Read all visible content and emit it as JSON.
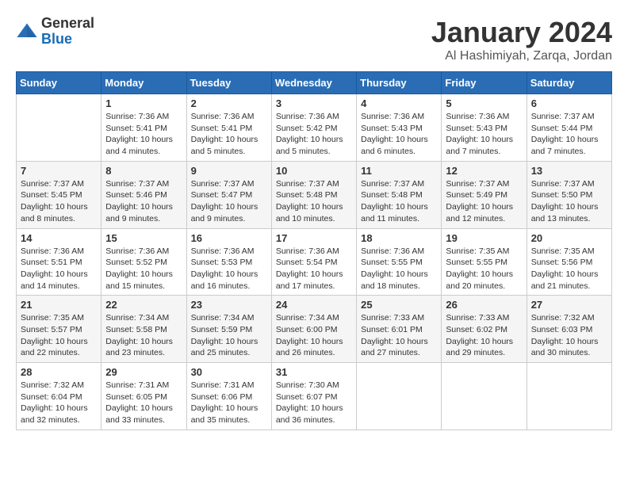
{
  "logo": {
    "text_general": "General",
    "text_blue": "Blue"
  },
  "title": "January 2024",
  "subtitle": "Al Hashimiyah, Zarqa, Jordan",
  "days_of_week": [
    "Sunday",
    "Monday",
    "Tuesday",
    "Wednesday",
    "Thursday",
    "Friday",
    "Saturday"
  ],
  "weeks": [
    [
      {
        "day": "",
        "sunrise": "",
        "sunset": "",
        "daylight": ""
      },
      {
        "day": "1",
        "sunrise": "Sunrise: 7:36 AM",
        "sunset": "Sunset: 5:41 PM",
        "daylight": "Daylight: 10 hours and 4 minutes."
      },
      {
        "day": "2",
        "sunrise": "Sunrise: 7:36 AM",
        "sunset": "Sunset: 5:41 PM",
        "daylight": "Daylight: 10 hours and 5 minutes."
      },
      {
        "day": "3",
        "sunrise": "Sunrise: 7:36 AM",
        "sunset": "Sunset: 5:42 PM",
        "daylight": "Daylight: 10 hours and 5 minutes."
      },
      {
        "day": "4",
        "sunrise": "Sunrise: 7:36 AM",
        "sunset": "Sunset: 5:43 PM",
        "daylight": "Daylight: 10 hours and 6 minutes."
      },
      {
        "day": "5",
        "sunrise": "Sunrise: 7:36 AM",
        "sunset": "Sunset: 5:43 PM",
        "daylight": "Daylight: 10 hours and 7 minutes."
      },
      {
        "day": "6",
        "sunrise": "Sunrise: 7:37 AM",
        "sunset": "Sunset: 5:44 PM",
        "daylight": "Daylight: 10 hours and 7 minutes."
      }
    ],
    [
      {
        "day": "7",
        "sunrise": "Sunrise: 7:37 AM",
        "sunset": "Sunset: 5:45 PM",
        "daylight": "Daylight: 10 hours and 8 minutes."
      },
      {
        "day": "8",
        "sunrise": "Sunrise: 7:37 AM",
        "sunset": "Sunset: 5:46 PM",
        "daylight": "Daylight: 10 hours and 9 minutes."
      },
      {
        "day": "9",
        "sunrise": "Sunrise: 7:37 AM",
        "sunset": "Sunset: 5:47 PM",
        "daylight": "Daylight: 10 hours and 9 minutes."
      },
      {
        "day": "10",
        "sunrise": "Sunrise: 7:37 AM",
        "sunset": "Sunset: 5:48 PM",
        "daylight": "Daylight: 10 hours and 10 minutes."
      },
      {
        "day": "11",
        "sunrise": "Sunrise: 7:37 AM",
        "sunset": "Sunset: 5:48 PM",
        "daylight": "Daylight: 10 hours and 11 minutes."
      },
      {
        "day": "12",
        "sunrise": "Sunrise: 7:37 AM",
        "sunset": "Sunset: 5:49 PM",
        "daylight": "Daylight: 10 hours and 12 minutes."
      },
      {
        "day": "13",
        "sunrise": "Sunrise: 7:37 AM",
        "sunset": "Sunset: 5:50 PM",
        "daylight": "Daylight: 10 hours and 13 minutes."
      }
    ],
    [
      {
        "day": "14",
        "sunrise": "Sunrise: 7:36 AM",
        "sunset": "Sunset: 5:51 PM",
        "daylight": "Daylight: 10 hours and 14 minutes."
      },
      {
        "day": "15",
        "sunrise": "Sunrise: 7:36 AM",
        "sunset": "Sunset: 5:52 PM",
        "daylight": "Daylight: 10 hours and 15 minutes."
      },
      {
        "day": "16",
        "sunrise": "Sunrise: 7:36 AM",
        "sunset": "Sunset: 5:53 PM",
        "daylight": "Daylight: 10 hours and 16 minutes."
      },
      {
        "day": "17",
        "sunrise": "Sunrise: 7:36 AM",
        "sunset": "Sunset: 5:54 PM",
        "daylight": "Daylight: 10 hours and 17 minutes."
      },
      {
        "day": "18",
        "sunrise": "Sunrise: 7:36 AM",
        "sunset": "Sunset: 5:55 PM",
        "daylight": "Daylight: 10 hours and 18 minutes."
      },
      {
        "day": "19",
        "sunrise": "Sunrise: 7:35 AM",
        "sunset": "Sunset: 5:55 PM",
        "daylight": "Daylight: 10 hours and 20 minutes."
      },
      {
        "day": "20",
        "sunrise": "Sunrise: 7:35 AM",
        "sunset": "Sunset: 5:56 PM",
        "daylight": "Daylight: 10 hours and 21 minutes."
      }
    ],
    [
      {
        "day": "21",
        "sunrise": "Sunrise: 7:35 AM",
        "sunset": "Sunset: 5:57 PM",
        "daylight": "Daylight: 10 hours and 22 minutes."
      },
      {
        "day": "22",
        "sunrise": "Sunrise: 7:34 AM",
        "sunset": "Sunset: 5:58 PM",
        "daylight": "Daylight: 10 hours and 23 minutes."
      },
      {
        "day": "23",
        "sunrise": "Sunrise: 7:34 AM",
        "sunset": "Sunset: 5:59 PM",
        "daylight": "Daylight: 10 hours and 25 minutes."
      },
      {
        "day": "24",
        "sunrise": "Sunrise: 7:34 AM",
        "sunset": "Sunset: 6:00 PM",
        "daylight": "Daylight: 10 hours and 26 minutes."
      },
      {
        "day": "25",
        "sunrise": "Sunrise: 7:33 AM",
        "sunset": "Sunset: 6:01 PM",
        "daylight": "Daylight: 10 hours and 27 minutes."
      },
      {
        "day": "26",
        "sunrise": "Sunrise: 7:33 AM",
        "sunset": "Sunset: 6:02 PM",
        "daylight": "Daylight: 10 hours and 29 minutes."
      },
      {
        "day": "27",
        "sunrise": "Sunrise: 7:32 AM",
        "sunset": "Sunset: 6:03 PM",
        "daylight": "Daylight: 10 hours and 30 minutes."
      }
    ],
    [
      {
        "day": "28",
        "sunrise": "Sunrise: 7:32 AM",
        "sunset": "Sunset: 6:04 PM",
        "daylight": "Daylight: 10 hours and 32 minutes."
      },
      {
        "day": "29",
        "sunrise": "Sunrise: 7:31 AM",
        "sunset": "Sunset: 6:05 PM",
        "daylight": "Daylight: 10 hours and 33 minutes."
      },
      {
        "day": "30",
        "sunrise": "Sunrise: 7:31 AM",
        "sunset": "Sunset: 6:06 PM",
        "daylight": "Daylight: 10 hours and 35 minutes."
      },
      {
        "day": "31",
        "sunrise": "Sunrise: 7:30 AM",
        "sunset": "Sunset: 6:07 PM",
        "daylight": "Daylight: 10 hours and 36 minutes."
      },
      {
        "day": "",
        "sunrise": "",
        "sunset": "",
        "daylight": ""
      },
      {
        "day": "",
        "sunrise": "",
        "sunset": "",
        "daylight": ""
      },
      {
        "day": "",
        "sunrise": "",
        "sunset": "",
        "daylight": ""
      }
    ]
  ]
}
